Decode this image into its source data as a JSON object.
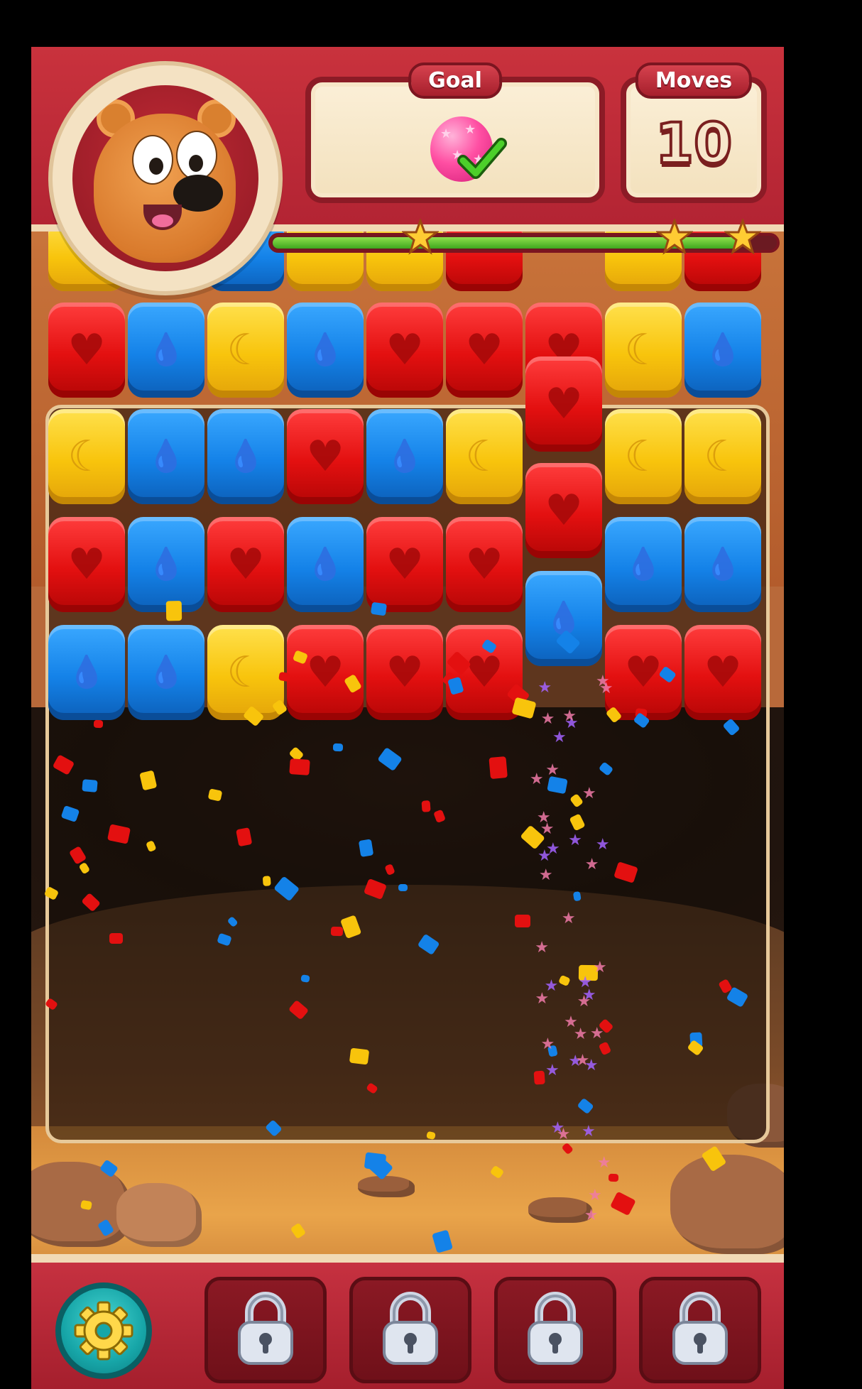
{
  "header": {
    "goal_label": "Goal",
    "goal_icon": "pink-star-balloon-icon",
    "goal_status_icon": "green-checkmark-icon",
    "moves_label": "Moves",
    "moves_value": "10",
    "avatar": "bear-character"
  },
  "progress": {
    "fraction": 0.92,
    "stars": [
      "star-icon",
      "star-icon",
      "star-icon"
    ]
  },
  "board": {
    "columns": 9,
    "tile_types": {
      "red": {
        "symbol": "♥",
        "color": "#e31010",
        "icon": "heart-icon"
      },
      "blue": {
        "symbol": "💧",
        "color": "#1482e8",
        "icon": "droplet-icon"
      },
      "yellow": {
        "symbol": "☾",
        "color": "#f8c40c",
        "icon": "moon-icon"
      }
    },
    "column_stacks": [
      [
        "red",
        "yellow",
        "red",
        "blue"
      ],
      [
        "blue",
        "blue",
        "blue",
        "blue"
      ],
      [
        "yellow",
        "blue",
        "red",
        "yellow"
      ],
      [
        "blue",
        "red",
        "blue",
        "red"
      ],
      [
        "red",
        "blue",
        "red",
        "red"
      ],
      [
        "red",
        "yellow",
        "red",
        "red"
      ],
      [
        "red",
        "red",
        "red",
        "blue"
      ],
      [
        "yellow",
        "yellow",
        "blue",
        "red"
      ],
      [
        "blue",
        "yellow",
        "blue",
        "red"
      ]
    ]
  },
  "toolbar": {
    "settings_icon": "gear-icon",
    "locked_boosters": [
      "lock-icon",
      "lock-icon",
      "lock-icon",
      "lock-icon"
    ]
  },
  "colors": {
    "header_red": "#c9323d",
    "panel_cream": "#fbefd7",
    "progress_green": "#3ea61e",
    "settings_teal": "#17a6a8"
  }
}
